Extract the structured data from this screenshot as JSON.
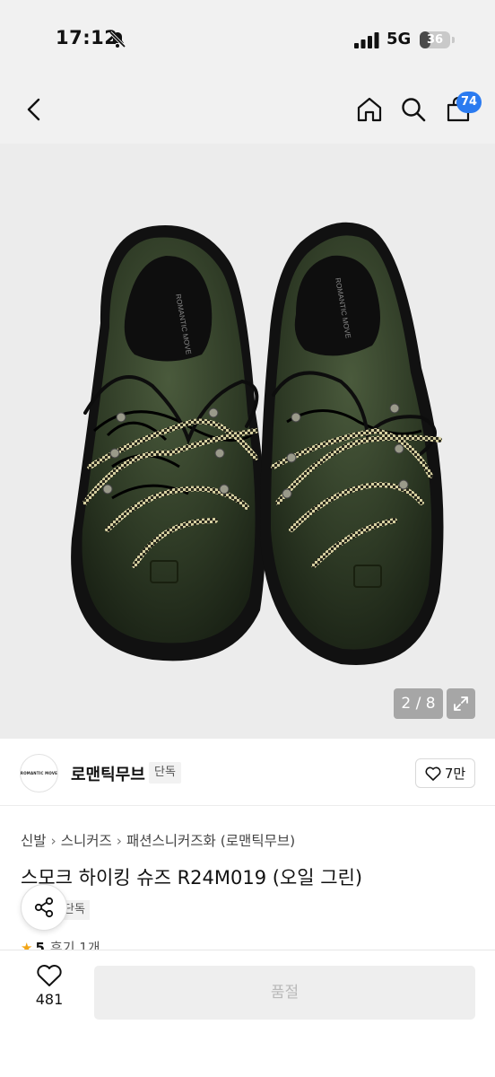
{
  "status_bar": {
    "time": "17:12",
    "network": "5G",
    "battery": "36",
    "battery_level": 0.36
  },
  "nav": {
    "cart_count": "74",
    "icons": [
      "back-arrow-icon",
      "home-icon",
      "search-icon",
      "cart-icon"
    ]
  },
  "product_image": {
    "page_indicator": "2 / 8",
    "shoe_brand_print": "ROMANTIC MOVE"
  },
  "brand": {
    "logo_text": "ROMANTIC MOVE",
    "name": "로맨틱무브",
    "exclusive_tag": "단독",
    "like_count": "7만"
  },
  "breadcrumb": [
    "신발",
    "스니커즈",
    "패션스니커즈화",
    "(로맨틱무브)"
  ],
  "product": {
    "title": "스모크 하이킹 슈즈 R24M019 (오일 그린)",
    "tag": "단독",
    "rating": "5",
    "reviews": "후기 1개"
  },
  "bottom_bar": {
    "wish_count": "481",
    "soldout_label": "품절"
  },
  "colors": {
    "accent_blue": "#2b7bf0",
    "star": "#f2a516",
    "shoe_leather": "#2e3a25"
  }
}
